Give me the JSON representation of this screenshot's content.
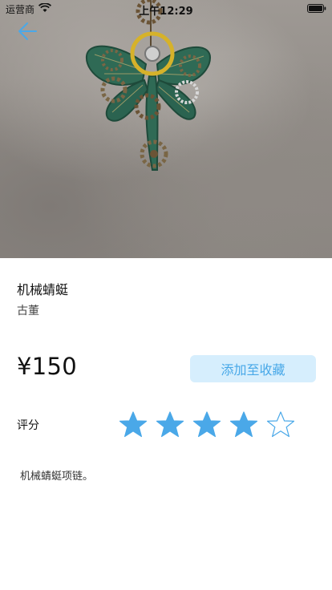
{
  "status_bar": {
    "carrier": "运营商",
    "time": "上午12:29",
    "icons": [
      "wifi-icon",
      "battery-icon"
    ]
  },
  "navigation": {
    "back_icon": "back-arrow-icon",
    "accent_color": "#4aa8e8"
  },
  "product": {
    "image": "mechanical-dragonfly-necklace-photo",
    "name": "机械蜻蜓",
    "category": "古董",
    "price": "¥150",
    "favorite_button_label": "添加至收藏",
    "rating_label": "评分",
    "rating": 4,
    "rating_max": 5,
    "description": "机械蜻蜓项链。"
  },
  "colors": {
    "accent": "#4aa8e8",
    "button_bg": "#d6eefd",
    "star_filled": "#4aa8e8"
  }
}
